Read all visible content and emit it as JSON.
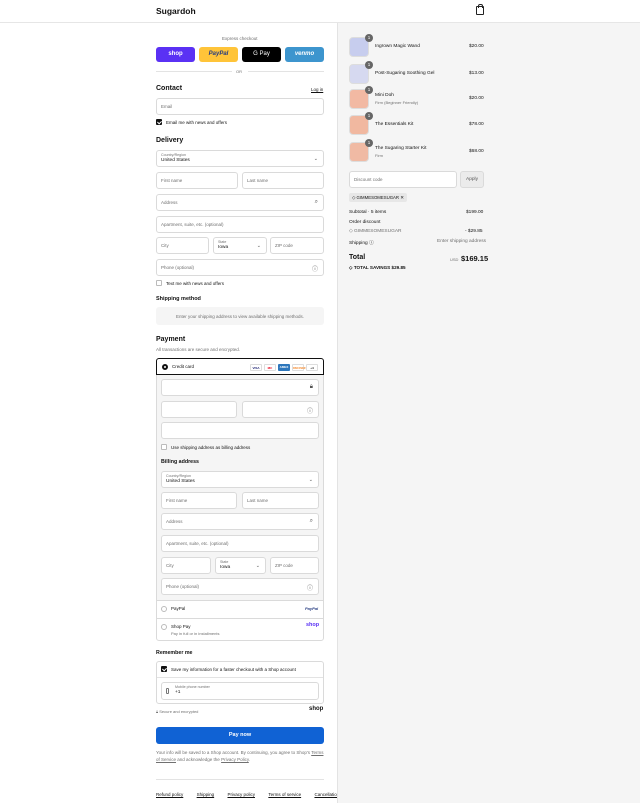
{
  "header": {
    "brand": "Sugardoh"
  },
  "express": {
    "title": "Express checkout",
    "shop": "shop",
    "paypal": "PayPal",
    "gpay": "G Pay",
    "venmo": "venmo",
    "or": "OR"
  },
  "contact": {
    "heading": "Contact",
    "login": "Log in",
    "email_placeholder": "Email",
    "news": "Email me with news and offers"
  },
  "delivery": {
    "heading": "Delivery",
    "country_label": "Country/Region",
    "country": "United States",
    "first": "First name",
    "last": "Last name",
    "address": "Address",
    "apt": "Apartment, suite, etc. (optional)",
    "city": "City",
    "state_label": "State",
    "state": "Iowa",
    "zip": "ZIP code",
    "phone": "Phone (optional)",
    "text_news": "Text me with news and offers"
  },
  "shipping_method": {
    "heading": "Shipping method",
    "note": "Enter your shipping address to view available shipping methods."
  },
  "payment": {
    "heading": "Payment",
    "sub": "All transactions are secure and encrypted.",
    "credit_card": "Credit card",
    "cards": [
      "VISA",
      "MC",
      "AMEX",
      "DISCOVER",
      "+4"
    ],
    "use_shipping": "Use shipping address as billing address",
    "paypal": "PayPal",
    "paypal_logo": "PayPal",
    "shop_pay": "Shop Pay",
    "shop_pay_sub": "Pay in full or in installments",
    "shop_logo": "shop"
  },
  "billing": {
    "heading": "Billing address",
    "country_label": "Country/Region",
    "country": "United States",
    "first": "First name",
    "last": "Last name",
    "address": "Address",
    "apt": "Apartment, suite, etc. (optional)",
    "city": "City",
    "state_label": "State",
    "state": "Iowa",
    "zip": "ZIP code",
    "phone": "Phone (optional)"
  },
  "remember": {
    "heading": "Remember me",
    "save": "Save my information for a faster checkout with a Shop account",
    "mobile_label": "Mobile phone number",
    "mobile_value": "+1",
    "secure": "Secure and encrypted",
    "shop": "shop"
  },
  "pay_now": "Pay now",
  "legal": {
    "pre": "Your info will be saved to a Shop account. By continuing, you agree to Shop's",
    "terms": "Terms of Service",
    "mid": "and acknowledge the",
    "privacy": "Privacy Policy",
    "end": "."
  },
  "footer": [
    "Refund policy",
    "Shipping",
    "Privacy policy",
    "Terms of service",
    "Cancellations"
  ],
  "order": {
    "items": [
      {
        "qty": "1",
        "name": "Ingrown Magic Wand",
        "sub": "",
        "price": "$20.00",
        "color": "#c7cdee"
      },
      {
        "qty": "1",
        "name": "Post-Sugaring Soothing Gel",
        "sub": "",
        "price": "$13.00",
        "color": "#d6d9f0"
      },
      {
        "qty": "1",
        "name": "Mini Doh",
        "sub": "Firm (Beginner Friendly)",
        "price": "$20.00",
        "color": "#f2b9a3"
      },
      {
        "qty": "1",
        "name": "The Essentials Kit",
        "sub": "",
        "price": "$78.00",
        "color": "#f1b8a0"
      },
      {
        "qty": "1",
        "name": "The Sugaring Starter Kit",
        "sub": "Firm",
        "price": "$68.00",
        "color": "#f0baa4"
      }
    ],
    "discount_placeholder": "Discount code",
    "apply": "Apply",
    "code": "GIMMESOMESUGAR",
    "subtotal_label": "Subtotal · 5 items",
    "subtotal": "$199.00",
    "order_discount": "Order discount",
    "discount_code": "GIMMESOMESUGAR",
    "discount_value": "- $29.85",
    "shipping_label": "Shipping",
    "shipping_value": "Enter shipping address",
    "total_label": "Total",
    "currency": "USD",
    "total": "$169.15",
    "savings_label": "TOTAL SAVINGS",
    "savings": "$29.85"
  }
}
